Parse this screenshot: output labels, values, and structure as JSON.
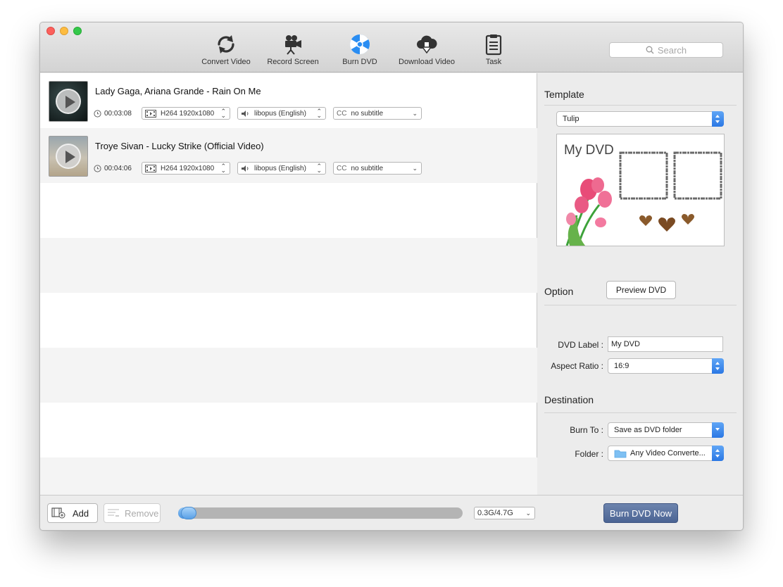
{
  "window": {
    "controls": [
      "close",
      "minimize",
      "zoom"
    ]
  },
  "toolbar": {
    "items": [
      {
        "label": "Convert Video",
        "icon": "convert-icon"
      },
      {
        "label": "Record Screen",
        "icon": "camera-icon"
      },
      {
        "label": "Burn DVD",
        "icon": "disc-icon"
      },
      {
        "label": "Download Video",
        "icon": "cloud-download-icon"
      },
      {
        "label": "Task",
        "icon": "clipboard-icon"
      }
    ],
    "search_placeholder": "Search"
  },
  "videos": [
    {
      "title": "Lady Gaga, Ariana Grande - Rain On Me",
      "duration": "00:03:08",
      "video": "H264 1920x1080",
      "audio": "libopus (English)",
      "subtitle": "no subtitle",
      "subtitle_prefix": "CC"
    },
    {
      "title": "Troye Sivan - Lucky Strike (Official Video)",
      "duration": "00:04:06",
      "video": "H264 1920x1080",
      "audio": "libopus (English)",
      "subtitle": "no subtitle",
      "subtitle_prefix": "CC"
    }
  ],
  "template": {
    "heading": "Template",
    "selected": "Tulip",
    "preview_title": "My DVD",
    "preview_button": "Preview DVD"
  },
  "option": {
    "heading": "Option",
    "dvd_label_caption": "DVD Label :",
    "dvd_label_value": "My DVD",
    "aspect_caption": "Aspect Ratio :",
    "aspect_value": "16:9"
  },
  "destination": {
    "heading": "Destination",
    "burn_to_caption": "Burn To :",
    "burn_to_value": "Save as DVD folder",
    "folder_caption": "Folder  :",
    "folder_value": "Any Video Converte..."
  },
  "bottom": {
    "add_label": "Add",
    "remove_label": "Remove",
    "progress_fraction": 0.064,
    "capacity": "0.3G/4.7G",
    "burn_button": "Burn DVD Now"
  }
}
